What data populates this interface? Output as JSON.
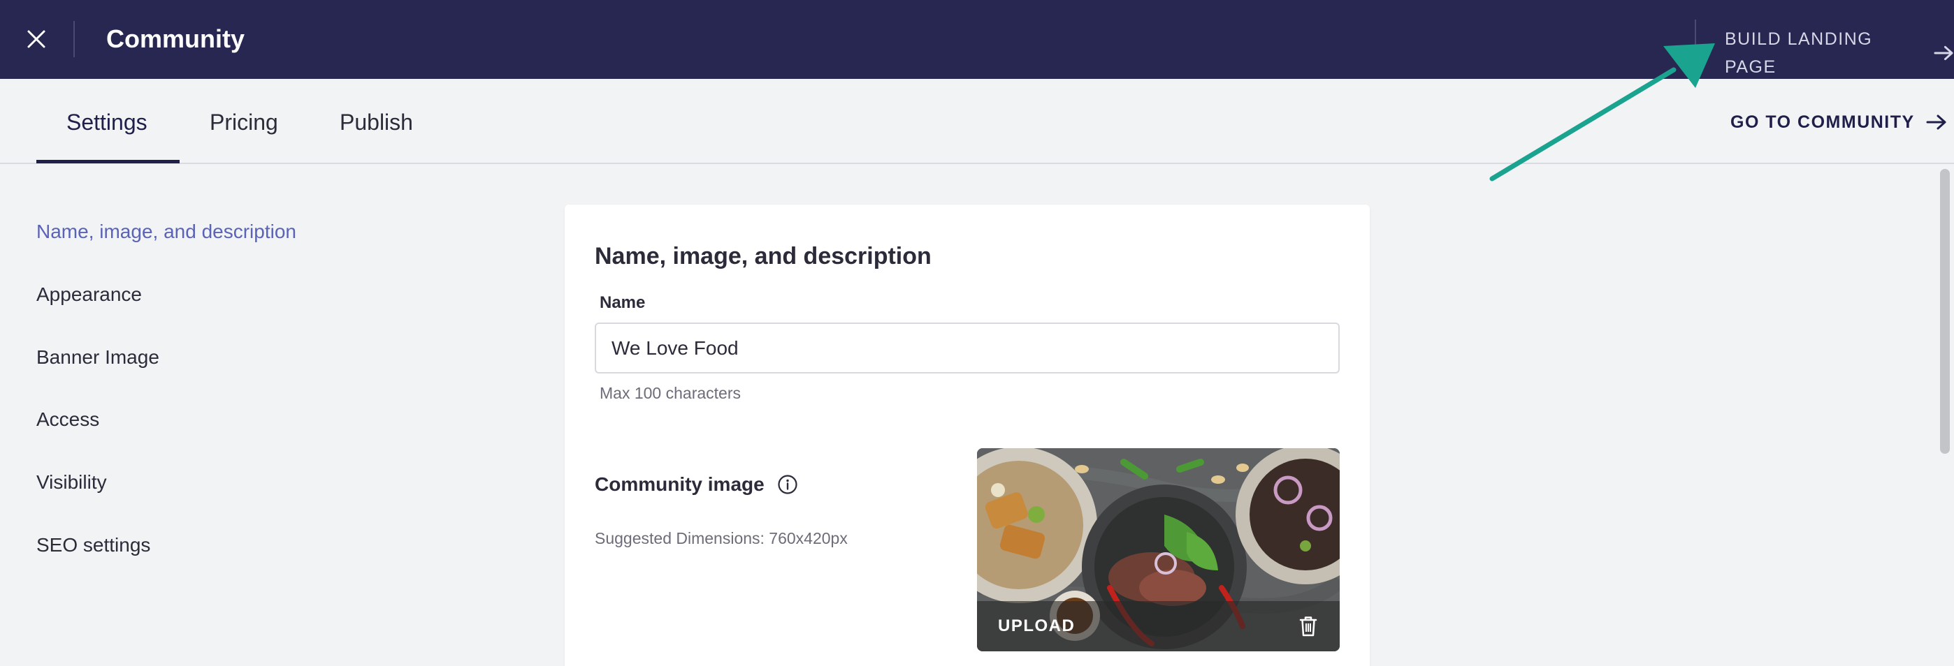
{
  "header": {
    "title": "Community",
    "build_landing_page": "BUILD LANDING PAGE"
  },
  "tabs": [
    {
      "label": "Settings",
      "active": true
    },
    {
      "label": "Pricing",
      "active": false
    },
    {
      "label": "Publish",
      "active": false
    }
  ],
  "go_to_community": "GO TO COMMUNITY",
  "sidebar": {
    "items": [
      {
        "label": "Name, image, and description",
        "active": true
      },
      {
        "label": "Appearance",
        "active": false
      },
      {
        "label": "Banner Image",
        "active": false
      },
      {
        "label": "Access",
        "active": false
      },
      {
        "label": "Visibility",
        "active": false
      },
      {
        "label": "SEO settings",
        "active": false
      }
    ]
  },
  "card": {
    "title": "Name, image, and description",
    "name_label": "Name",
    "name_value": "We Love Food",
    "name_helper": "Max 100 characters",
    "image_label": "Community image",
    "image_dims": "Suggested Dimensions: 760x420px",
    "upload_label": "UPLOAD"
  },
  "colors": {
    "header_bg": "#272752",
    "accent": "#5a63b8",
    "annotation_arrow": "#1aa38f"
  },
  "icons": [
    "close-icon",
    "arrow-right-icon",
    "info-icon",
    "trash-icon"
  ]
}
